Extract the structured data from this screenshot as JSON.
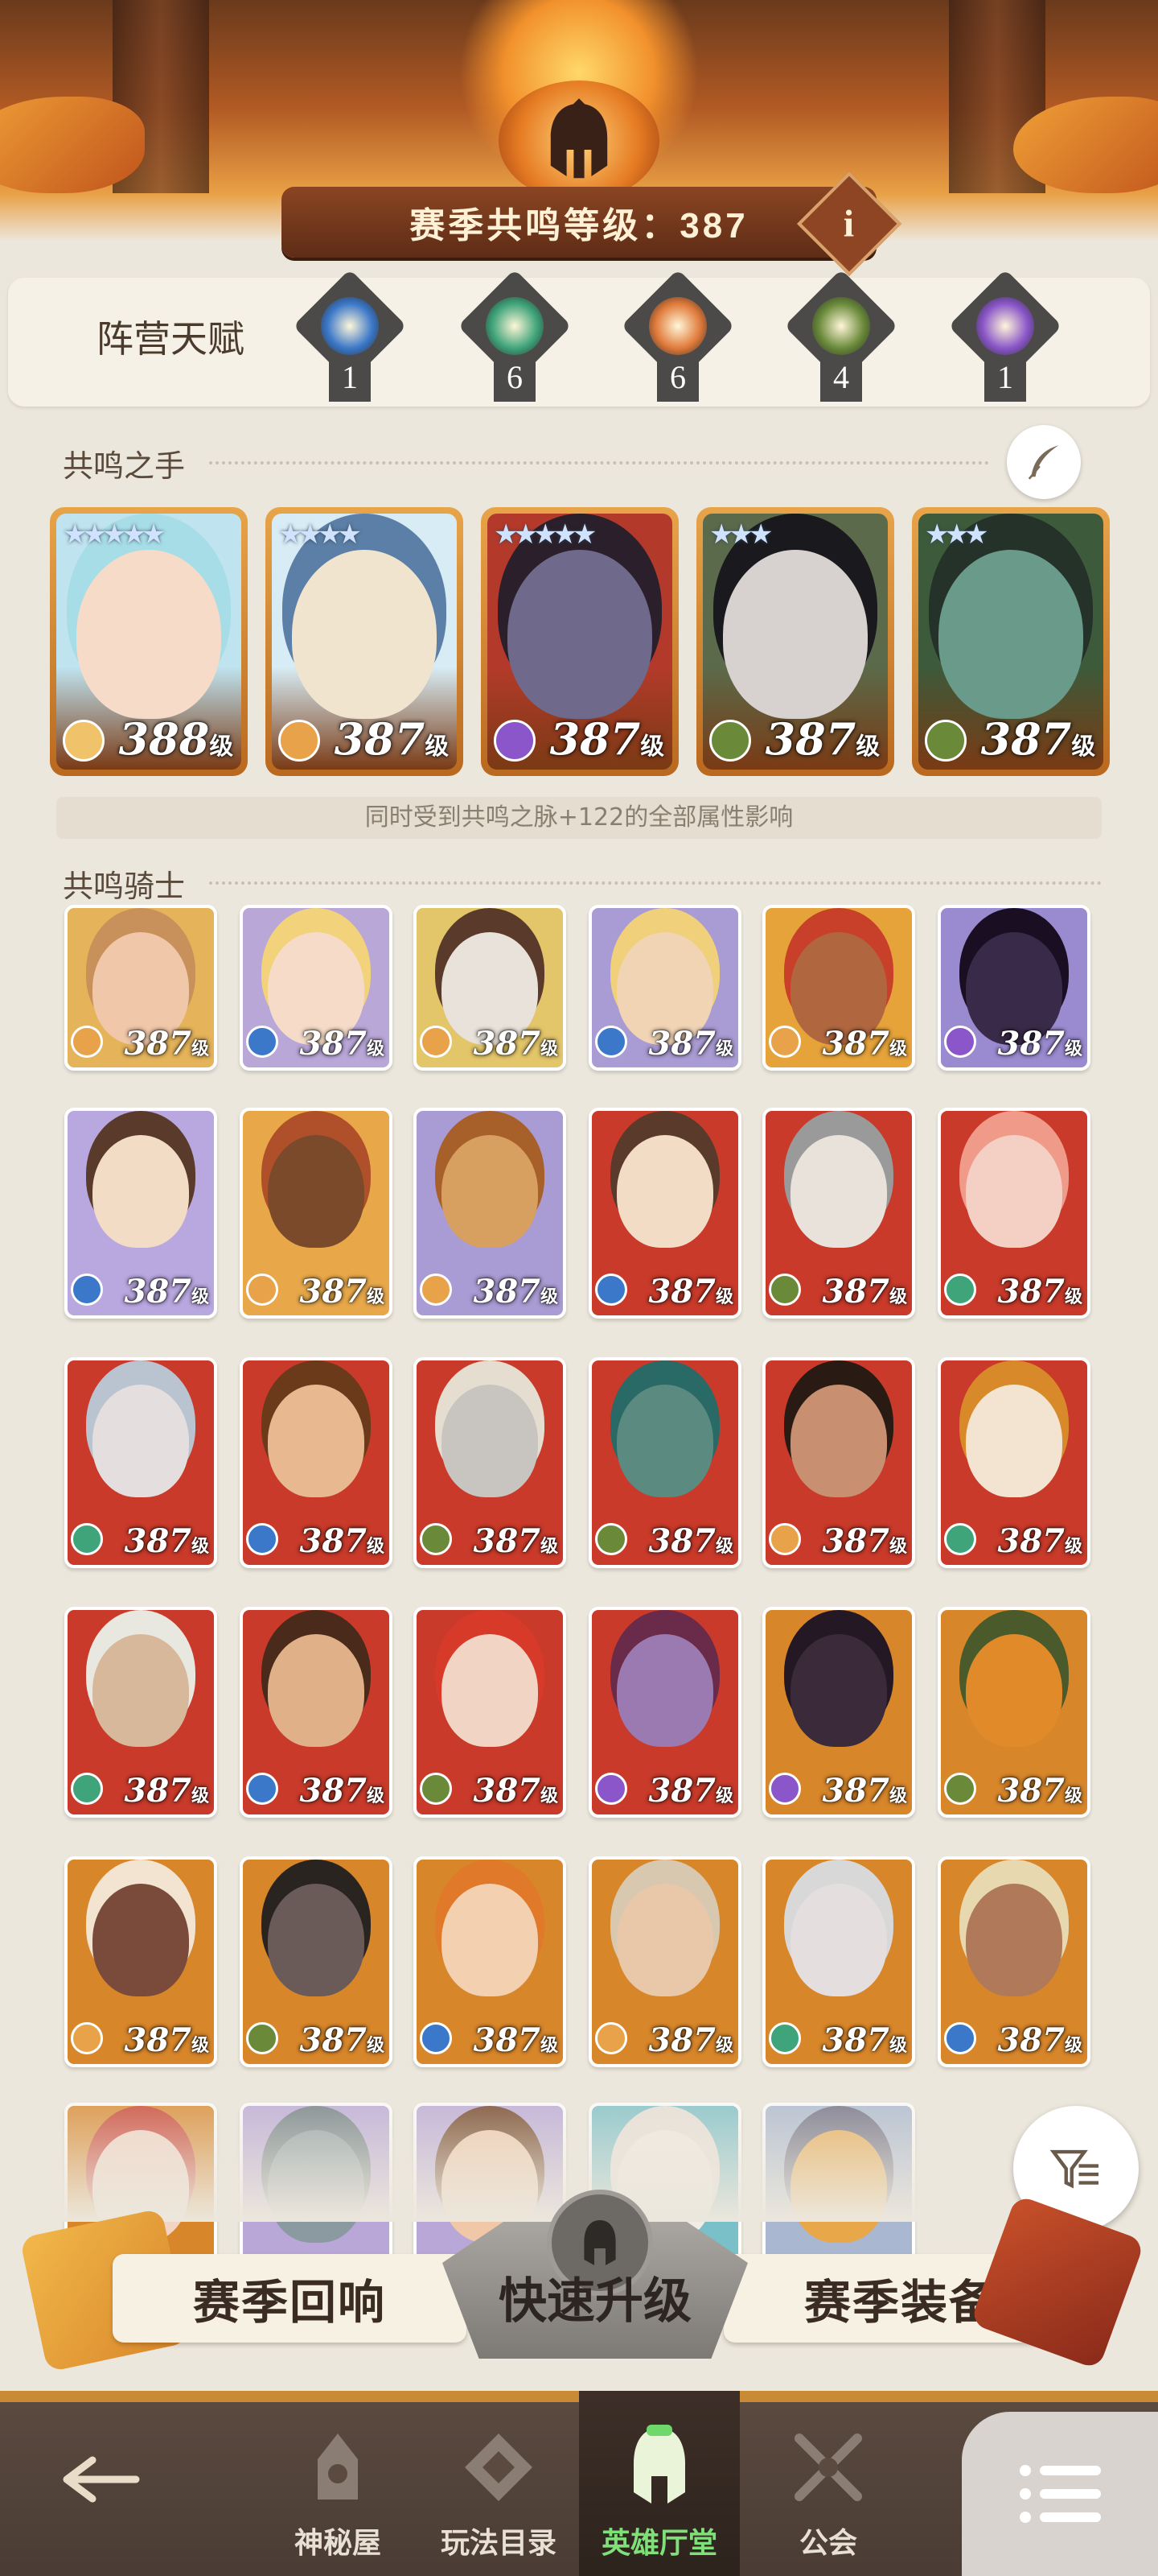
{
  "header": {
    "season_level_text": "赛季共鸣等级：387",
    "info_label": "i"
  },
  "talents": {
    "label": "阵营天赋",
    "items": [
      {
        "name": "lightbearer-faction-icon",
        "count": "1",
        "color": "#3b78c9"
      },
      {
        "name": "wilder-faction-icon",
        "count": "6",
        "color": "#3fa47a"
      },
      {
        "name": "graveborn-faction-icon",
        "count": "6",
        "color": "#e07a3a"
      },
      {
        "name": "mauler-faction-icon",
        "count": "4",
        "color": "#6a8a3a"
      },
      {
        "name": "celestial-faction-icon",
        "count": "1",
        "color": "#8a56c9"
      }
    ]
  },
  "resonance_hands": {
    "title": "共鸣之手",
    "note": "同时受到共鸣之脉+122的全部属性影响",
    "heroes": [
      {
        "level": "388",
        "unit": "级",
        "stars": "★★★★★",
        "bg": "#bfe3ef",
        "skin": "#f6dcc8",
        "hair": "#a7dde6",
        "fac": "#f0c36a"
      },
      {
        "level": "387",
        "unit": "级",
        "stars": "★★★★",
        "bg": "#d7ecf4",
        "skin": "#f1e4cf",
        "hair": "#5b7fa6",
        "fac": "#e8a24a"
      },
      {
        "level": "387",
        "unit": "级",
        "stars": "★★★★★",
        "bg": "#b33a2a",
        "skin": "#6f6a8c",
        "hair": "#2a1f2a",
        "fac": "#8a56c9"
      },
      {
        "level": "387",
        "unit": "级",
        "stars": "★★★",
        "bg": "#5b6a4a",
        "skin": "#d7d2cf",
        "hair": "#1a1a1e",
        "fac": "#6a8a3a"
      },
      {
        "level": "387",
        "unit": "级",
        "stars": "★★★",
        "bg": "#3d5a3a",
        "skin": "#6a9a8a",
        "hair": "#24322a",
        "fac": "#6a8a3a"
      }
    ]
  },
  "resonance_knights": {
    "title": "共鸣骑士",
    "rows": [
      [
        {
          "level": "387",
          "unit": "级",
          "bg": "#e4b35a",
          "skin": "#f0c7a8",
          "hair": "#c8905a",
          "fac": "#e8a24a"
        },
        {
          "level": "387",
          "unit": "级",
          "bg": "#b9a7d8",
          "skin": "#f6dcc8",
          "hair": "#f2d27a",
          "fac": "#3b78c9"
        },
        {
          "level": "387",
          "unit": "级",
          "bg": "#e3c56a",
          "skin": "#e9e2da",
          "hair": "#5a3a2a",
          "fac": "#e8a24a"
        },
        {
          "level": "387",
          "unit": "级",
          "bg": "#a99bd3",
          "skin": "#f1d4b4",
          "hair": "#f0d07a",
          "fac": "#3b78c9"
        },
        {
          "level": "387",
          "unit": "级",
          "bg": "#e6a33a",
          "skin": "#b0673f",
          "hair": "#c8402a",
          "fac": "#e8a24a"
        },
        {
          "level": "387",
          "unit": "级",
          "bg": "#9a8ad0",
          "skin": "#3a2a4a",
          "hair": "#1a0f22",
          "fac": "#8a56c9"
        }
      ],
      [
        {
          "level": "387",
          "unit": "级",
          "bg": "#b9a7e0",
          "skin": "#f2dcc6",
          "hair": "#5a3a2a",
          "fac": "#3b78c9"
        },
        {
          "level": "387",
          "unit": "级",
          "bg": "#e8a84a",
          "skin": "#7a4a2a",
          "hair": "#b0502a",
          "fac": "#e8a24a"
        },
        {
          "level": "387",
          "unit": "级",
          "bg": "#a99bd3",
          "skin": "#d8a060",
          "hair": "#a8602a",
          "fac": "#e8a24a"
        },
        {
          "level": "387",
          "unit": "级",
          "bg": "#c93a2a",
          "skin": "#f2dcc6",
          "hair": "#5a3a2a",
          "fac": "#3b78c9"
        },
        {
          "level": "387",
          "unit": "级",
          "bg": "#c93a2a",
          "skin": "#e9e2da",
          "hair": "#9a9a9a",
          "fac": "#6a8a3a"
        },
        {
          "level": "387",
          "unit": "级",
          "bg": "#c93a2a",
          "skin": "#f4d0c4",
          "hair": "#f09a8a",
          "fac": "#3fa47a"
        }
      ],
      [
        {
          "level": "387",
          "unit": "级",
          "bg": "#c93a2a",
          "skin": "#e4dede",
          "hair": "#b9c4d0",
          "fac": "#3fa47a"
        },
        {
          "level": "387",
          "unit": "级",
          "bg": "#c93a2a",
          "skin": "#e8b890",
          "hair": "#6a3a1a",
          "fac": "#3b78c9"
        },
        {
          "level": "387",
          "unit": "级",
          "bg": "#c93a2a",
          "skin": "#c8c4c0",
          "hair": "#e4ddd0",
          "fac": "#6a8a3a"
        },
        {
          "level": "387",
          "unit": "级",
          "bg": "#c93a2a",
          "skin": "#5a8a80",
          "hair": "#2a6a66",
          "fac": "#6a8a3a"
        },
        {
          "level": "387",
          "unit": "级",
          "bg": "#c93a2a",
          "skin": "#c89070",
          "hair": "#2a1a14",
          "fac": "#e8a24a"
        },
        {
          "level": "387",
          "unit": "级",
          "bg": "#c93a2a",
          "skin": "#f2e4d0",
          "hair": "#d88a2a",
          "fac": "#3fa47a"
        }
      ],
      [
        {
          "level": "387",
          "unit": "级",
          "bg": "#c93a2a",
          "skin": "#d8b89a",
          "hair": "#e8e8e0",
          "fac": "#3fa47a"
        },
        {
          "level": "387",
          "unit": "级",
          "bg": "#c93a2a",
          "skin": "#e0b088",
          "hair": "#4a2a1a",
          "fac": "#3b78c9"
        },
        {
          "level": "387",
          "unit": "级",
          "bg": "#c93a2a",
          "skin": "#f2d4c4",
          "hair": "#d83a2a",
          "fac": "#6a8a3a"
        },
        {
          "level": "387",
          "unit": "级",
          "bg": "#c93a2a",
          "skin": "#9a7ab0",
          "hair": "#6a2a4a",
          "fac": "#8a56c9"
        },
        {
          "level": "387",
          "unit": "级",
          "bg": "#d8862a",
          "skin": "#3a2a3a",
          "hair": "#241824",
          "fac": "#8a56c9"
        },
        {
          "level": "387",
          "unit": "级",
          "bg": "#d8862a",
          "skin": "#e08a2a",
          "hair": "#4a5a2a",
          "fac": "#6a8a3a"
        }
      ],
      [
        {
          "level": "387",
          "unit": "级",
          "bg": "#d8862a",
          "skin": "#7a4a3a",
          "hair": "#f2e4d0",
          "fac": "#e8a24a"
        },
        {
          "level": "387",
          "unit": "级",
          "bg": "#d8862a",
          "skin": "#6a5a58",
          "hair": "#2a2420",
          "fac": "#6a8a3a"
        },
        {
          "level": "387",
          "unit": "级",
          "bg": "#d8862a",
          "skin": "#f2d0b0",
          "hair": "#e07a2a",
          "fac": "#3b78c9"
        },
        {
          "level": "387",
          "unit": "级",
          "bg": "#d8862a",
          "skin": "#e8c8a8",
          "hair": "#d8c8b0",
          "fac": "#e8a24a"
        },
        {
          "level": "387",
          "unit": "级",
          "bg": "#d8862a",
          "skin": "#e4dede",
          "hair": "#d8d8d8",
          "fac": "#3fa47a"
        },
        {
          "level": "387",
          "unit": "级",
          "bg": "#d8862a",
          "skin": "#b07a5a",
          "hair": "#e8d8b0",
          "fac": "#3b78c9"
        }
      ],
      [
        {
          "bg": "#d8862a",
          "skin": "#f2d4c4",
          "hair": "#c83a2a"
        },
        {
          "bg": "#b9a7d8",
          "skin": "#8a9aa0",
          "hair": "#6a7a80"
        },
        {
          "bg": "#b9a7d8",
          "skin": "#f0c8a8",
          "hair": "#6a3a1a"
        },
        {
          "bg": "#7ac0c8",
          "skin": "#f2ece4",
          "hair": "#e8e0d8"
        },
        {
          "bg": "#a9b8d0",
          "skin": "#e8a84a",
          "hair": "#6a6a80"
        }
      ]
    ]
  },
  "actions": {
    "season_echo": "赛季回响",
    "quick_upgrade": "快速升级",
    "season_gear": "赛季装备"
  },
  "nav": {
    "items": [
      {
        "label": "神秘屋",
        "icon": "mystic-house-icon"
      },
      {
        "label": "玩法目录",
        "icon": "mode-catalog-icon"
      },
      {
        "label": "英雄厅堂",
        "icon": "hero-hall-icon"
      },
      {
        "label": "公会",
        "icon": "guild-icon"
      }
    ]
  }
}
